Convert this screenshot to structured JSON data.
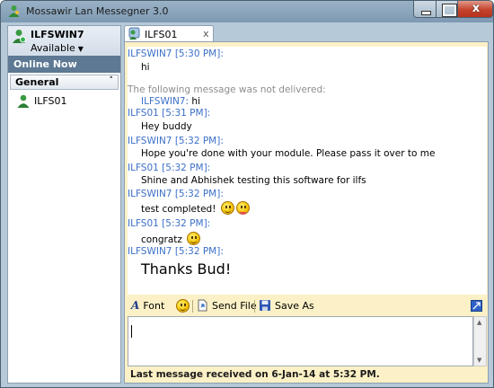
{
  "window": {
    "title": "Mossawir Lan Messegner 3.0",
    "close_glyph": "x"
  },
  "user": {
    "name": "ILFSWIN7",
    "status": "Available",
    "status_caret": "▼"
  },
  "sidebar": {
    "online_now": "Online Now",
    "group": "General",
    "group_chevron": "˄",
    "contacts": [
      {
        "name": "ILFS01"
      }
    ]
  },
  "tab": {
    "label": "ILFS01",
    "close": "x"
  },
  "chat": {
    "messages": [
      {
        "sender": "ILFSWIN7 [5:30 PM]:",
        "text": "hi"
      },
      {
        "notice": "The following message was not delivered:",
        "who": "ILFSWIN7:",
        "text": "hi"
      },
      {
        "sender": "ILFS01 [5:31 PM]:",
        "text": "Hey buddy"
      },
      {
        "sender": "ILFSWIN7 [5:32 PM]:",
        "text": "Hope you're done with your module. Please pass it over to me"
      },
      {
        "sender": "ILFS01 [5:32 PM]:",
        "text": "Shine and Abhishek testing this software for ilfs"
      },
      {
        "sender": "ILFSWIN7 [5:32 PM]:",
        "text": "test completed!"
      },
      {
        "sender": "ILFS01 [5:32 PM]:",
        "text": "congratz"
      },
      {
        "sender": "ILFSWIN7 [5:32 PM]:",
        "text": "Thanks Bud!"
      }
    ]
  },
  "toolbar": {
    "font": "Font",
    "send_file": "Send File",
    "save_as": "Save As"
  },
  "input": {
    "value": ""
  },
  "status": {
    "text": "Last message received on 6-Jan-14 at 5:32 PM."
  },
  "colors": {
    "sender": "#3c70c9",
    "notice": "#8d8d8d",
    "chat_frame": "#fcf1c6",
    "online_now_bg": "#5d7993"
  },
  "icons": [
    "messenger-icon",
    "user-icon",
    "contact-icon",
    "chat-tab-icon",
    "smiley-icon",
    "tongue-icon",
    "font-icon",
    "send-file-icon",
    "save-icon",
    "expand-icon"
  ]
}
